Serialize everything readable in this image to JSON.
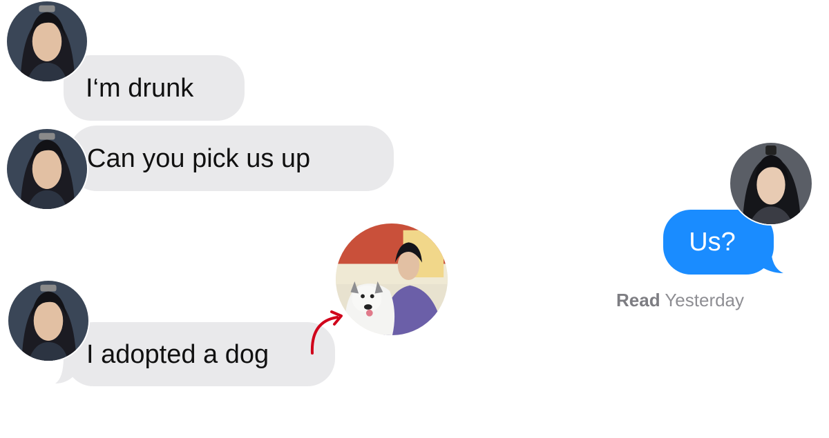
{
  "conversation": {
    "incoming": [
      {
        "text": "I‘m drunk"
      },
      {
        "text": "Can you pick us up"
      },
      {
        "text": "I adopted a dog"
      }
    ],
    "outgoing": [
      {
        "text": "Us?"
      }
    ],
    "receipt": {
      "status": "Read",
      "time": "Yesterday"
    }
  },
  "colors": {
    "incoming_bubble": "#e9e9eb",
    "outgoing_bubble": "#1a8cff",
    "annotation_arrow": "#d0021b"
  },
  "icons": {
    "sender_avatar": "contact-photo",
    "receiver_avatar": "contact-photo",
    "dog_photo": "photo-man-with-husky",
    "arrow": "curved-arrow"
  }
}
